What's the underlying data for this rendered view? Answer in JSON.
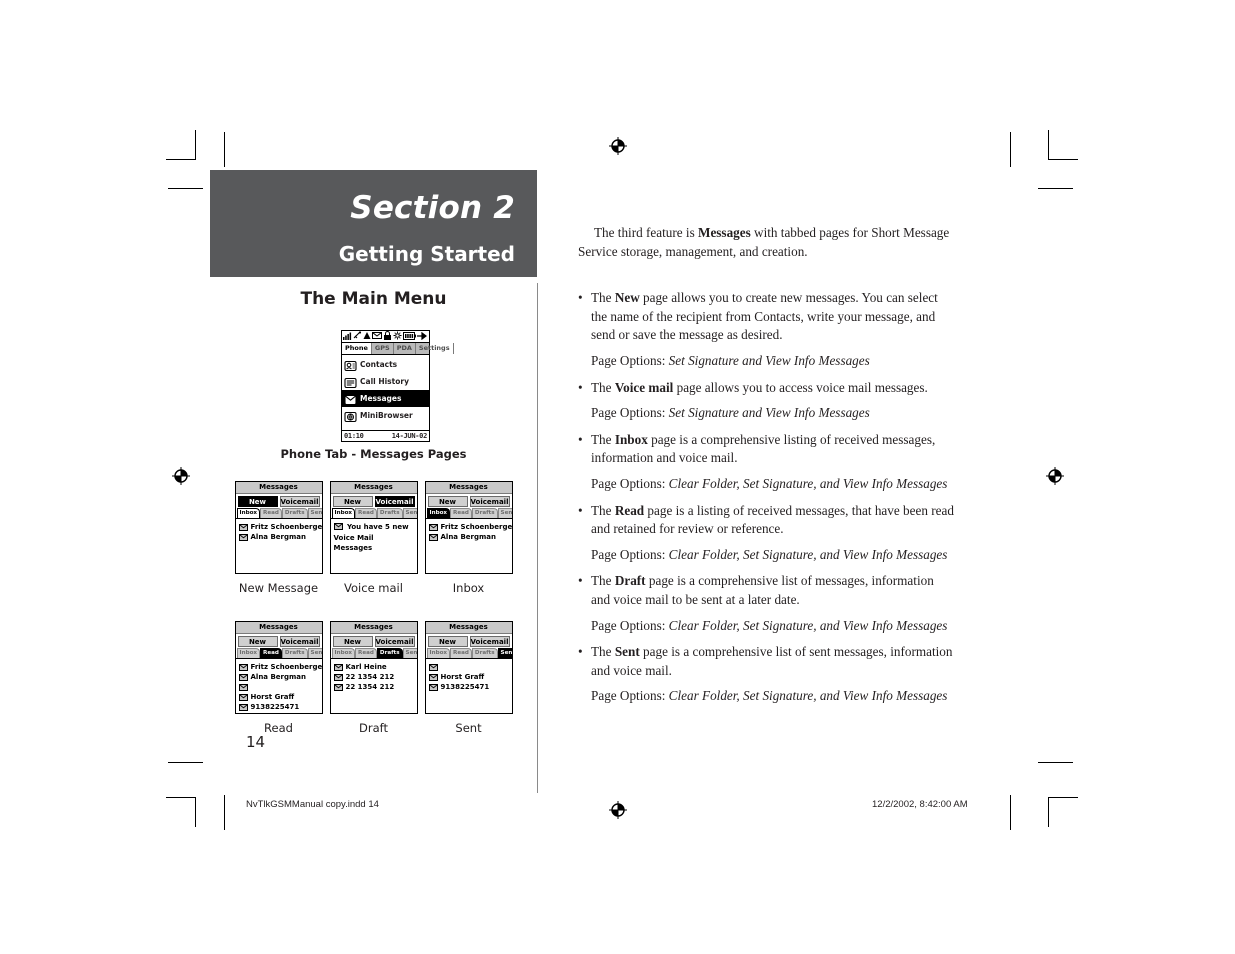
{
  "section": {
    "number": "Section 2",
    "subtitle": "Getting Started"
  },
  "left": {
    "heading": "The Main Menu",
    "figure_caption": "Phone Tab - Messages Pages",
    "page_number": "14"
  },
  "main_device": {
    "status_icons": [
      "signal-bars-icon",
      "satellite-icon",
      "warning-triangle-icon",
      "envelope-icon",
      "lock-icon",
      "settings-icon",
      "battery-icon",
      "arrow-icon"
    ],
    "tabs": [
      {
        "label": "Phone",
        "active": true
      },
      {
        "label": "GPS",
        "active": false
      },
      {
        "label": "PDA",
        "active": false
      },
      {
        "label": "Settings",
        "active": false
      }
    ],
    "menu_items": [
      {
        "label": "Contacts",
        "icon": "contacts-icon",
        "selected": false
      },
      {
        "label": "Call History",
        "icon": "call-history-icon",
        "selected": false
      },
      {
        "label": "Messages",
        "icon": "messages-icon",
        "selected": true
      },
      {
        "label": "MiniBrowser",
        "icon": "minibrowser-icon",
        "selected": false
      }
    ],
    "status_time": "01:10",
    "status_date": "14-JUN-02"
  },
  "screenshots": [
    {
      "caption": "New Message",
      "title": "Messages",
      "buttons": [
        {
          "label": "New",
          "active": true
        },
        {
          "label": "Voicemail",
          "active": false
        }
      ],
      "tabs": [
        {
          "label": "Inbox",
          "state": "first"
        },
        {
          "label": "Read",
          "state": "off"
        },
        {
          "label": "Drafts",
          "state": "off"
        },
        {
          "label": "Sent",
          "state": "off"
        }
      ],
      "rows": [
        {
          "icon": "envelope-icon",
          "label": "Fritz Schoenberge"
        },
        {
          "icon": "envelope-icon",
          "label": "Alna Bergman"
        }
      ],
      "message": null
    },
    {
      "caption": "Voice mail",
      "title": "Messages",
      "buttons": [
        {
          "label": "New",
          "active": false
        },
        {
          "label": "Voicemail",
          "active": true
        }
      ],
      "tabs": [
        {
          "label": "Inbox",
          "state": "first"
        },
        {
          "label": "Read",
          "state": "off"
        },
        {
          "label": "Drafts",
          "state": "off"
        },
        {
          "label": "Sent",
          "state": "off"
        }
      ],
      "rows": [],
      "message": "You have 5 new Voice Mail Messages"
    },
    {
      "caption": "Inbox",
      "title": "Messages",
      "buttons": [
        {
          "label": "New",
          "active": false
        },
        {
          "label": "Voicemail",
          "active": false
        }
      ],
      "tabs": [
        {
          "label": "Inbox",
          "state": "on"
        },
        {
          "label": "Read",
          "state": "off"
        },
        {
          "label": "Drafts",
          "state": "off"
        },
        {
          "label": "Sent",
          "state": "off"
        }
      ],
      "rows": [
        {
          "icon": "envelope-icon",
          "label": "Fritz Schoenberge"
        },
        {
          "icon": "envelope-icon",
          "label": "Alna Bergman"
        }
      ],
      "message": null
    },
    {
      "caption": "Read",
      "title": "Messages",
      "buttons": [
        {
          "label": "New",
          "active": false
        },
        {
          "label": "Voicemail",
          "active": false
        }
      ],
      "tabs": [
        {
          "label": "Inbox",
          "state": "off"
        },
        {
          "label": "Read",
          "state": "on"
        },
        {
          "label": "Drafts",
          "state": "off"
        },
        {
          "label": "Sent",
          "state": "off"
        }
      ],
      "rows": [
        {
          "icon": "envelope-icon",
          "label": "Fritz Schoenberge"
        },
        {
          "icon": "envelope-icon",
          "label": "Alna Bergman"
        },
        {
          "icon": "envelope-icon",
          "label": ""
        },
        {
          "icon": "envelope-icon",
          "label": "Horst Graff"
        },
        {
          "icon": "envelope-icon",
          "label": "9138225471"
        }
      ],
      "message": null
    },
    {
      "caption": "Draft",
      "title": "Messages",
      "buttons": [
        {
          "label": "New",
          "active": false
        },
        {
          "label": "Voicemail",
          "active": false
        }
      ],
      "tabs": [
        {
          "label": "Inbox",
          "state": "off"
        },
        {
          "label": "Read",
          "state": "off"
        },
        {
          "label": "Drafts",
          "state": "on"
        },
        {
          "label": "Sent",
          "state": "off"
        }
      ],
      "rows": [
        {
          "icon": "envelope-icon",
          "label": "Karl Heine"
        },
        {
          "icon": "envelope-icon",
          "label": "22 1354 212"
        },
        {
          "icon": "envelope-icon",
          "label": "22 1354 212"
        }
      ],
      "message": null
    },
    {
      "caption": "Sent",
      "title": "Messages",
      "buttons": [
        {
          "label": "New",
          "active": false
        },
        {
          "label": "Voicemail",
          "active": false
        }
      ],
      "tabs": [
        {
          "label": "Inbox",
          "state": "off"
        },
        {
          "label": "Read",
          "state": "off"
        },
        {
          "label": "Drafts",
          "state": "off"
        },
        {
          "label": "Sent",
          "state": "on"
        }
      ],
      "rows": [
        {
          "icon": "envelope-icon",
          "label": ""
        },
        {
          "icon": "envelope-icon",
          "label": "Horst Graff"
        },
        {
          "icon": "envelope-icon",
          "label": "9138225471"
        }
      ],
      "message": null
    }
  ],
  "body": {
    "intro": "The third feature is Messages with tabbed pages for Short Message Service storage, management, and creation.",
    "intro_parts": {
      "a": "The third feature is ",
      "bold": "Messages",
      "b": " with tabbed pages for Short Message Service storage, management, and creation."
    },
    "bullets": [
      {
        "bullet_char": "•",
        "pre": "The ",
        "term": "New",
        "post": " page allows you to create new messages. You can select the name of the recipient from Contacts, write your message, and send or save the message as desired.",
        "options_label": "Page Options: ",
        "options_value": "Set Signature and View Info Messages"
      },
      {
        "bullet_char": "•",
        "pre": "The ",
        "term": "Voice mail",
        "post": " page allows you to access voice mail messages.",
        "options_label": "Page Options: ",
        "options_value": "Set Signature and View Info Messages"
      },
      {
        "bullet_char": "•",
        "pre": "The ",
        "term": "Inbox",
        "post": " page is a comprehensive listing of received messages, information and voice mail.",
        "options_label": "Page Options: ",
        "options_value": "Clear Folder, Set Signature, and View Info Messages"
      },
      {
        "bullet_char": "•",
        "pre": "The ",
        "term": "Read",
        "post": " page is a listing of received messages, that have been read and retained for review or reference.",
        "options_label": "Page Options: ",
        "options_value": "Clear Folder, Set Signature, and View Info Messages"
      },
      {
        "bullet_char": "•",
        "pre": "The ",
        "term": "Draft",
        "post": " page is a comprehensive list of messages, information and voice mail to be sent at a later date.",
        "options_label": "Page Options: ",
        "options_value": "Clear Folder, Set Signature, and View Info Messages"
      },
      {
        "bullet_char": "•",
        "pre": "The ",
        "term": "Sent",
        "post": " page is a comprehensive list of sent messages, information and voice mail.",
        "options_label": "Page Options: ",
        "options_value": "Clear Folder, Set Signature, and View Info Messages"
      }
    ]
  },
  "footer": {
    "left": "NvTlkGSMManual copy.indd   14",
    "right": "12/2/2002, 8:42:00 AM"
  },
  "colors": {
    "banner": "#58595b",
    "text": "#231f20",
    "lcd_gray": "#c9c9c9"
  }
}
